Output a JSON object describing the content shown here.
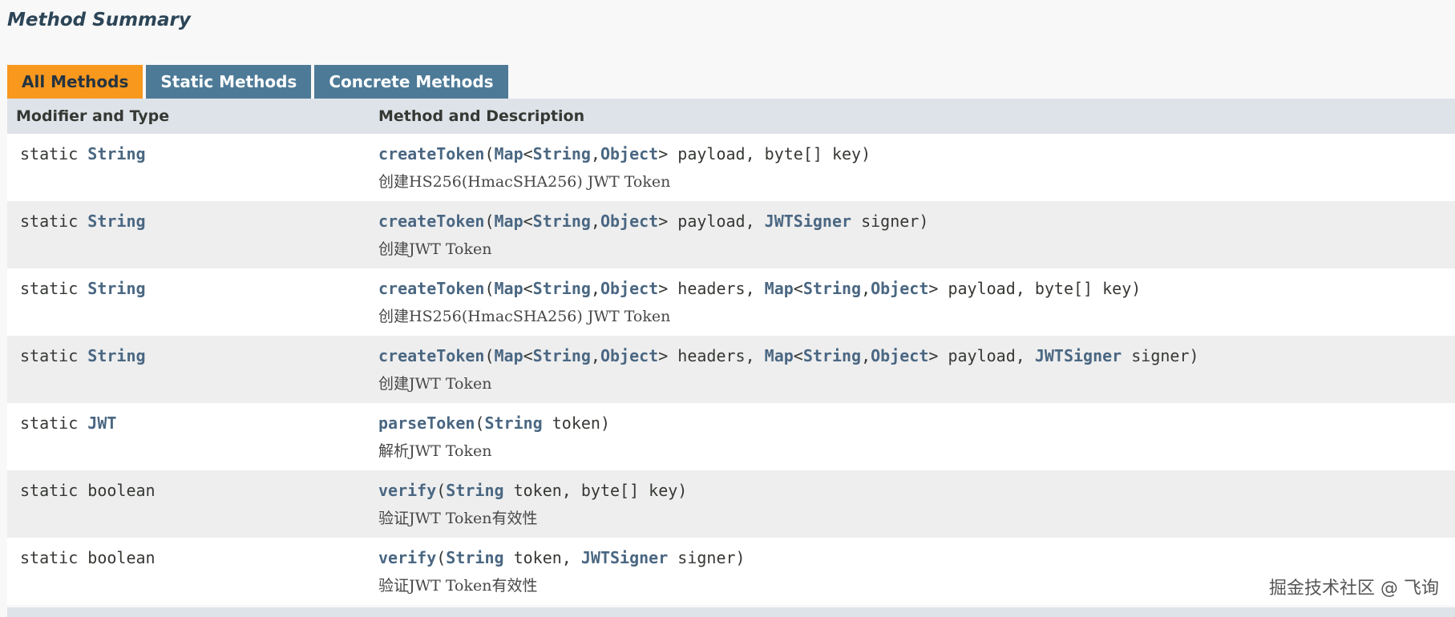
{
  "section_title": "Method Summary",
  "tabs": [
    {
      "label": "All Methods",
      "active": true
    },
    {
      "label": "Static Methods",
      "active": false
    },
    {
      "label": "Concrete Methods",
      "active": false
    }
  ],
  "table": {
    "headers": [
      "Modifier and Type",
      "Method and Description"
    ],
    "rows": [
      {
        "modifier": "static",
        "type": "String",
        "type_is_link": true,
        "signature": [
          {
            "t": "createToken",
            "k": "name"
          },
          {
            "t": "(",
            "k": "plain"
          },
          {
            "t": "Map",
            "k": "link"
          },
          {
            "t": "<",
            "k": "plain"
          },
          {
            "t": "String",
            "k": "link"
          },
          {
            "t": ",",
            "k": "plain"
          },
          {
            "t": "Object",
            "k": "link"
          },
          {
            "t": "> payload, byte[] key)",
            "k": "plain"
          }
        ],
        "description": "创建HS256(HmacSHA256) JWT Token"
      },
      {
        "modifier": "static",
        "type": "String",
        "type_is_link": true,
        "signature": [
          {
            "t": "createToken",
            "k": "name"
          },
          {
            "t": "(",
            "k": "plain"
          },
          {
            "t": "Map",
            "k": "link"
          },
          {
            "t": "<",
            "k": "plain"
          },
          {
            "t": "String",
            "k": "link"
          },
          {
            "t": ",",
            "k": "plain"
          },
          {
            "t": "Object",
            "k": "link"
          },
          {
            "t": "> payload, ",
            "k": "plain"
          },
          {
            "t": "JWTSigner",
            "k": "link"
          },
          {
            "t": " signer)",
            "k": "plain"
          }
        ],
        "description": "创建JWT Token"
      },
      {
        "modifier": "static",
        "type": "String",
        "type_is_link": true,
        "signature": [
          {
            "t": "createToken",
            "k": "name"
          },
          {
            "t": "(",
            "k": "plain"
          },
          {
            "t": "Map",
            "k": "link"
          },
          {
            "t": "<",
            "k": "plain"
          },
          {
            "t": "String",
            "k": "link"
          },
          {
            "t": ",",
            "k": "plain"
          },
          {
            "t": "Object",
            "k": "link"
          },
          {
            "t": "> headers, ",
            "k": "plain"
          },
          {
            "t": "Map",
            "k": "link"
          },
          {
            "t": "<",
            "k": "plain"
          },
          {
            "t": "String",
            "k": "link"
          },
          {
            "t": ",",
            "k": "plain"
          },
          {
            "t": "Object",
            "k": "link"
          },
          {
            "t": "> payload, byte[] key)",
            "k": "plain"
          }
        ],
        "description": "创建HS256(HmacSHA256) JWT Token"
      },
      {
        "modifier": "static",
        "type": "String",
        "type_is_link": true,
        "signature": [
          {
            "t": "createToken",
            "k": "name"
          },
          {
            "t": "(",
            "k": "plain"
          },
          {
            "t": "Map",
            "k": "link"
          },
          {
            "t": "<",
            "k": "plain"
          },
          {
            "t": "String",
            "k": "link"
          },
          {
            "t": ",",
            "k": "plain"
          },
          {
            "t": "Object",
            "k": "link"
          },
          {
            "t": "> headers, ",
            "k": "plain"
          },
          {
            "t": "Map",
            "k": "link"
          },
          {
            "t": "<",
            "k": "plain"
          },
          {
            "t": "String",
            "k": "link"
          },
          {
            "t": ",",
            "k": "plain"
          },
          {
            "t": "Object",
            "k": "link"
          },
          {
            "t": "> payload, ",
            "k": "plain"
          },
          {
            "t": "JWTSigner",
            "k": "link"
          },
          {
            "t": " signer)",
            "k": "plain"
          }
        ],
        "description": "创建JWT Token"
      },
      {
        "modifier": "static",
        "type": "JWT",
        "type_is_link": true,
        "signature": [
          {
            "t": "parseToken",
            "k": "name"
          },
          {
            "t": "(",
            "k": "plain"
          },
          {
            "t": "String",
            "k": "link"
          },
          {
            "t": " token)",
            "k": "plain"
          }
        ],
        "description": "解析JWT Token"
      },
      {
        "modifier": "static",
        "type": "boolean",
        "type_is_link": false,
        "signature": [
          {
            "t": "verify",
            "k": "name"
          },
          {
            "t": "(",
            "k": "plain"
          },
          {
            "t": "String",
            "k": "link"
          },
          {
            "t": " token, byte[] key)",
            "k": "plain"
          }
        ],
        "description": "验证JWT Token有效性"
      },
      {
        "modifier": "static",
        "type": "boolean",
        "type_is_link": false,
        "signature": [
          {
            "t": "verify",
            "k": "name"
          },
          {
            "t": "(",
            "k": "plain"
          },
          {
            "t": "String",
            "k": "link"
          },
          {
            "t": " token, ",
            "k": "plain"
          },
          {
            "t": "JWTSigner",
            "k": "link"
          },
          {
            "t": " signer)",
            "k": "plain"
          }
        ],
        "description": "验证JWT Token有效性"
      }
    ]
  },
  "watermark": "掘金技术社区 @ 飞询",
  "colors": {
    "active_tab": "#f8981d",
    "inactive_tab": "#4d7a97",
    "header_bg": "#dee3e9",
    "link": "#4a6782"
  }
}
